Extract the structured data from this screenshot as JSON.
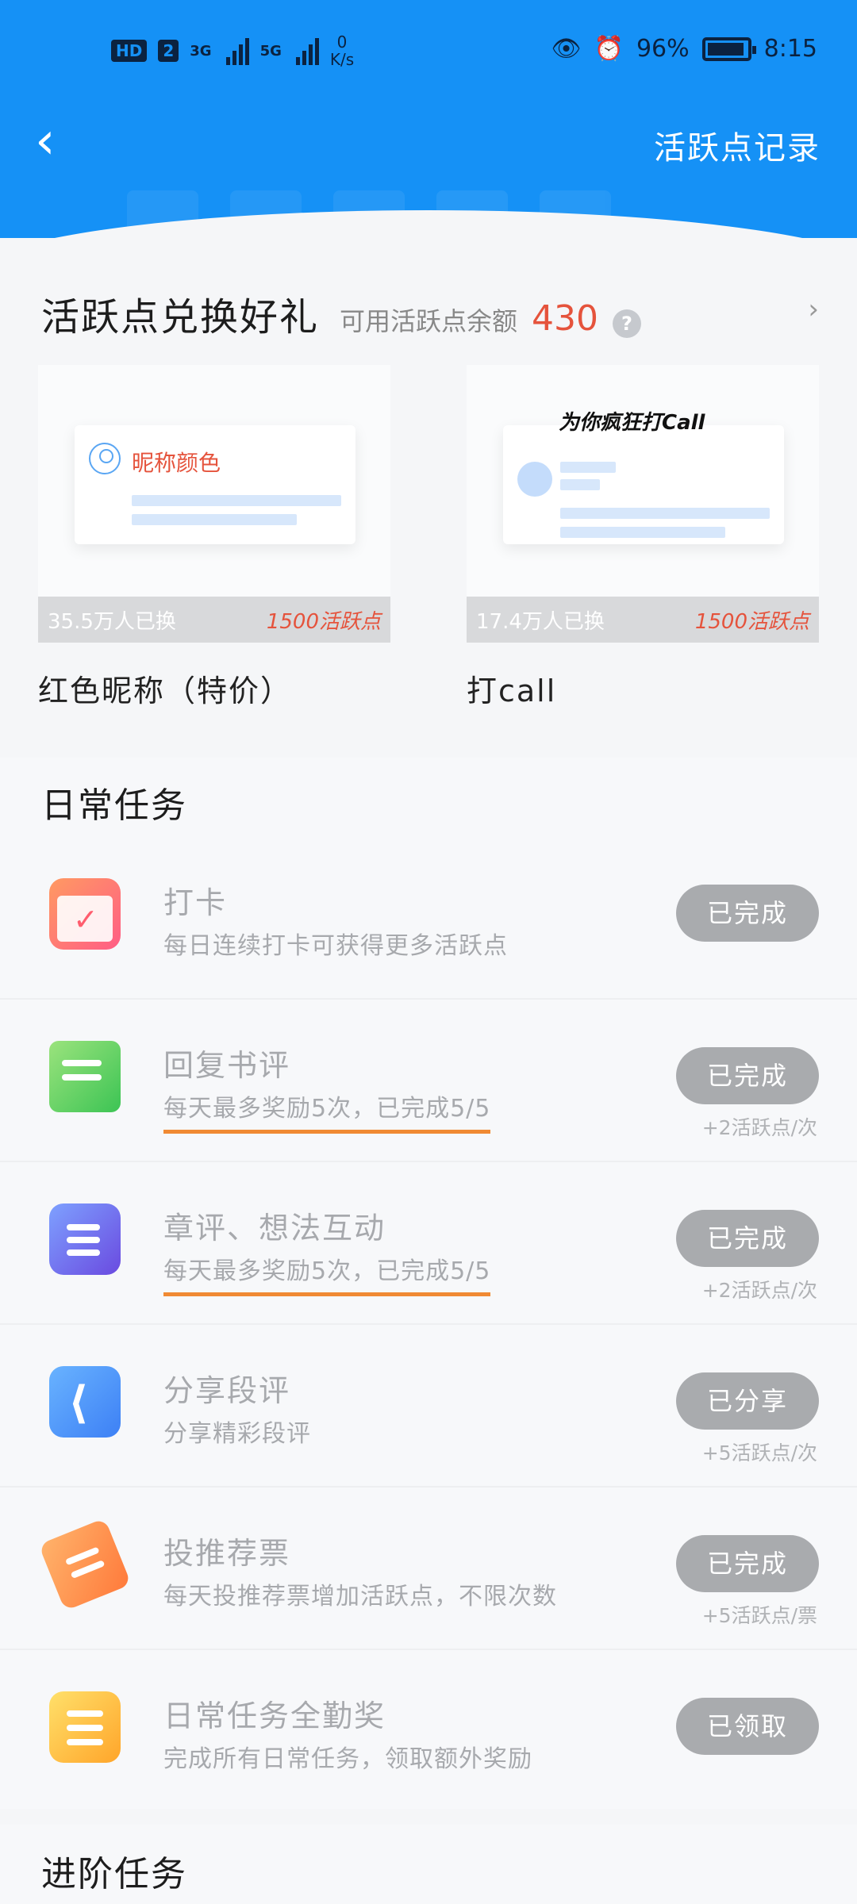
{
  "status_bar": {
    "network_badge_hd": "HD",
    "network_badge_sim": "2",
    "signal_1_label": "3G",
    "signal_2_label": "5G",
    "speed_value": "0",
    "speed_unit": "K/s",
    "battery": "96%",
    "time": "8:15"
  },
  "nav": {
    "back_label": "‹",
    "record_link": "活跃点记录"
  },
  "exchange": {
    "title": "活跃点兑换好礼",
    "balance_label": "可用活跃点余额",
    "balance_value": "430",
    "help_label": "?",
    "arrow": "›",
    "items": [
      {
        "preview_text": "昵称颜色",
        "exchanged": "35.5万人已换",
        "cost": "1500活跃点",
        "name": "红色昵称（特价）"
      },
      {
        "preview_text": "为你疯狂打Call",
        "exchanged": "17.4万人已换",
        "cost": "1500活跃点",
        "name": "打call"
      }
    ]
  },
  "daily": {
    "title": "日常任务",
    "tasks": [
      {
        "icon": "calendar-icon",
        "name": "打卡",
        "desc": "每日连续打卡可获得更多活跃点",
        "button": "已完成",
        "reward": ""
      },
      {
        "icon": "chat-bubbles-icon",
        "name": "回复书评",
        "desc": "每天最多奖励5次，已完成5/5",
        "button": "已完成",
        "reward": "+2活跃点/次"
      },
      {
        "icon": "comment-document-icon",
        "name": "章评、想法互动",
        "desc": "每天最多奖励5次，已完成5/5",
        "button": "已完成",
        "reward": "+2活跃点/次"
      },
      {
        "icon": "share-icon",
        "name": "分享段评",
        "desc": "分享精彩段评",
        "button": "已分享",
        "reward": "+5活跃点/次"
      },
      {
        "icon": "ticket-icon",
        "name": "投推荐票",
        "desc": "每天投推荐票增加活跃点，不限次数",
        "button": "已完成",
        "reward": "+5活跃点/票"
      },
      {
        "icon": "checklist-icon",
        "name": "日常任务全勤奖",
        "desc": "完成所有日常任务，领取额外奖励",
        "button": "已领取",
        "reward": ""
      }
    ]
  },
  "advanced": {
    "title": "进阶任务"
  },
  "colors": {
    "header_blue": "#1591f6",
    "accent_red": "#e5533c",
    "done_button": "#a9abae",
    "progress_underline": "#f08a33"
  }
}
